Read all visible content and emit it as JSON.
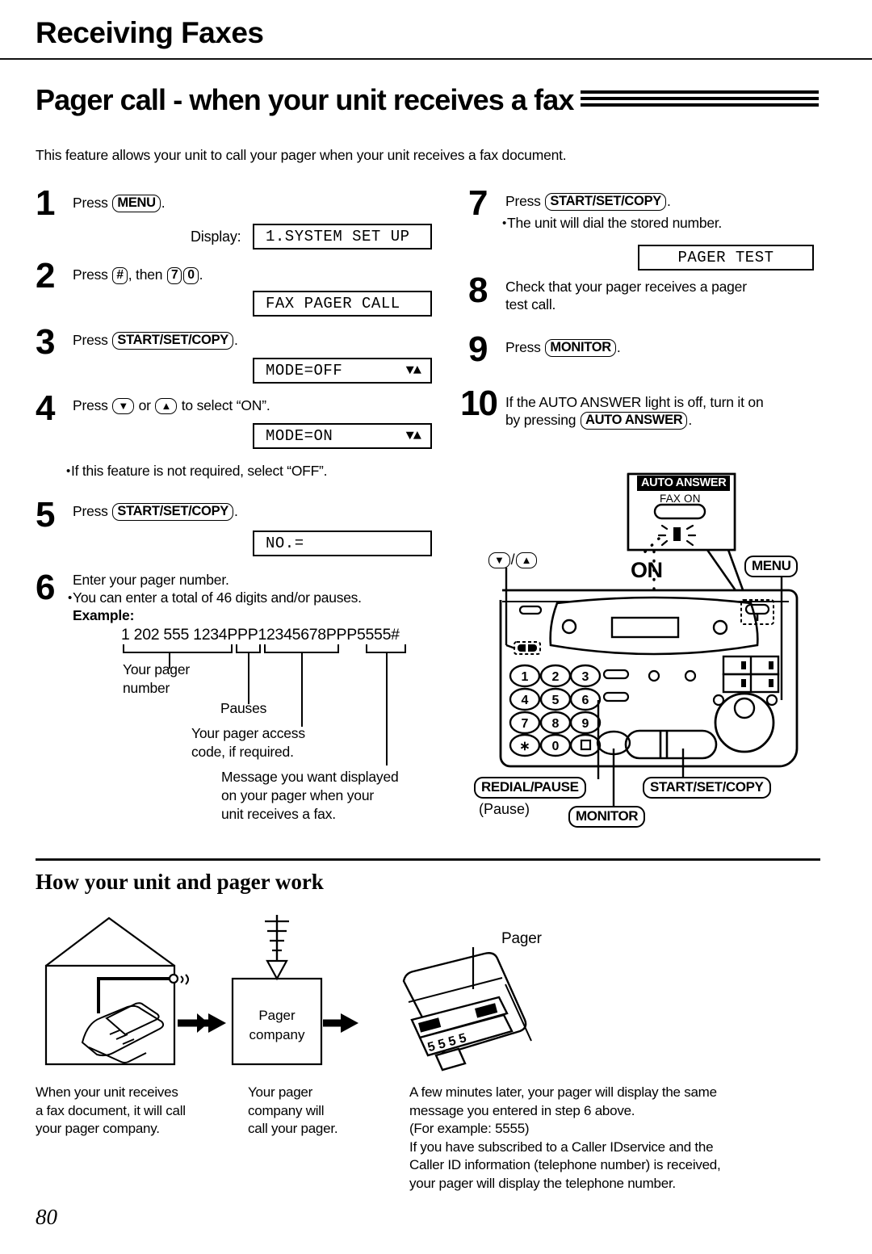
{
  "page": {
    "running_head": "Receiving Faxes",
    "chapter_title": "Pager call - when your unit receives a fax",
    "intro": "This feature allows your unit to call your pager when your unit receives a fax document.",
    "page_number": "80"
  },
  "steps_left": [
    {
      "num": "1",
      "line1_pre": "Press ",
      "key1": "MENU",
      "line1_post": ".",
      "display_label": "Display:",
      "lcd": "1.SYSTEM SET UP"
    },
    {
      "num": "2",
      "line1_pre": "Press ",
      "key1": "#",
      "line1_mid": ", then ",
      "key2": "7",
      "key3": "0",
      "line1_post": ".",
      "lcd": "FAX PAGER CALL"
    },
    {
      "num": "3",
      "line1_pre": "Press ",
      "key1": "START/SET/COPY",
      "line1_post": ".",
      "lcd": "MODE=OFF",
      "lcd_arrows": "▼▲"
    },
    {
      "num": "4",
      "line1_pre": "Press ",
      "key1": "▼",
      "line1_mid": " or ",
      "key2": "▲",
      "line1_post": " to select “ON”.",
      "lcd": "MODE=ON",
      "lcd_arrows": "▼▲",
      "note": "If this feature is not required, select “OFF”."
    },
    {
      "num": "5",
      "line1_pre": "Press ",
      "key1": "START/SET/COPY",
      "line1_post": ".",
      "lcd": "NO.="
    },
    {
      "num": "6",
      "line1": "Enter your pager number.",
      "note": "You can enter a total of 46 digits and/or pauses.",
      "example_label": "Example:",
      "example_number": "1 202 555 1234PPP12345678PPP5555#"
    }
  ],
  "example_labels": {
    "pager_number": "Your pager\nnumber",
    "pauses": "Pauses",
    "access_code": "Your pager access\ncode, if required.",
    "message": "Message you want displayed\non your pager when your\nunit receives a fax."
  },
  "steps_right": [
    {
      "num": "7",
      "line1_pre": "Press ",
      "key1": "START/SET/COPY",
      "line1_post": ".",
      "note": "The unit will dial the stored number.",
      "lcd": "PAGER TEST"
    },
    {
      "num": "8",
      "line1": "Check that your pager receives a pager",
      "line2": "test call."
    },
    {
      "num": "9",
      "line1_pre": "Press ",
      "key1": "MONITOR",
      "line1_post": "."
    },
    {
      "num": "10",
      "line1": "If the AUTO ANSWER light is off, turn it on",
      "line2_pre": "by pressing ",
      "key1": "AUTO ANSWER",
      "line2_post": "."
    }
  ],
  "machine": {
    "auto_answer_badge": "AUTO ANSWER",
    "fax_on_label": "FAX ON",
    "on_label": "ON",
    "menu_callout": "MENU",
    "updown_callout_sep": "/",
    "updown_down": "▼",
    "updown_up": "▲",
    "redial_callout": "REDIAL/PAUSE",
    "pause_callout": "(Pause)",
    "monitor_callout": "MONITOR",
    "start_callout": "START/SET/COPY",
    "keypad": [
      "1",
      "2",
      "3",
      "4",
      "5",
      "6",
      "7",
      "8",
      "9",
      "∗",
      "0",
      "□"
    ]
  },
  "section": {
    "title": "How your unit and pager work",
    "diagram": {
      "pager_company_line1": "Pager",
      "pager_company_line2": "company",
      "pager_label": "Pager",
      "pager_display": "5555"
    },
    "captions": [
      "When your unit receives\na fax document, it will call\nyour pager company.",
      "Your pager\ncompany will\ncall your pager.",
      "A few minutes later, your pager will display the same\nmessage you entered in step 6 above.\n(For example: 5555)\nIf you have subscribed to a Caller IDservice and the\nCaller ID information (telephone number) is received,\nyour pager will display the telephone number."
    ]
  }
}
